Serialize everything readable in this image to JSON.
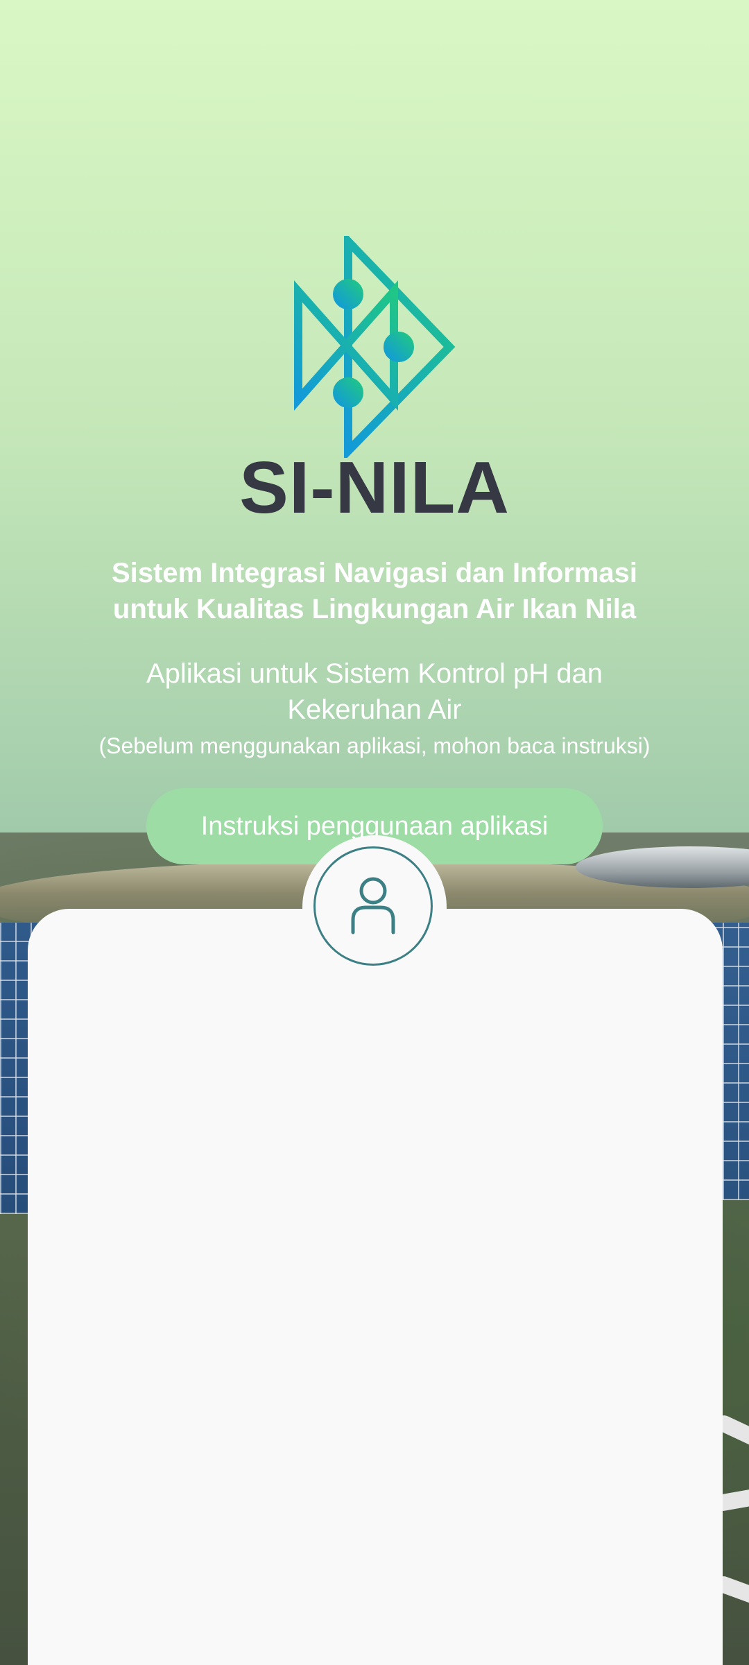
{
  "app": {
    "name": "SI-NILA",
    "tagline_line1": "Sistem Integrasi Navigasi dan Informasi",
    "tagline_line2": "untuk Kualitas Lingkungan Air Ikan Nila",
    "subtitle_line1": "Aplikasi untuk Sistem Kontrol pH dan",
    "subtitle_line2": "Kekeruhan Air",
    "note": "(Sebelum menggunakan aplikasi, mohon baca instruksi)"
  },
  "actions": {
    "instructions_label": "Instruksi penggunaan aplikasi"
  },
  "icons": {
    "logo": "fish-circuit-logo",
    "avatar": "user-icon"
  },
  "colors": {
    "accent_button": "#9edca6",
    "brand_text": "#363844",
    "avatar_stroke": "#3c7f84",
    "card_bg": "#f9f9f9"
  }
}
